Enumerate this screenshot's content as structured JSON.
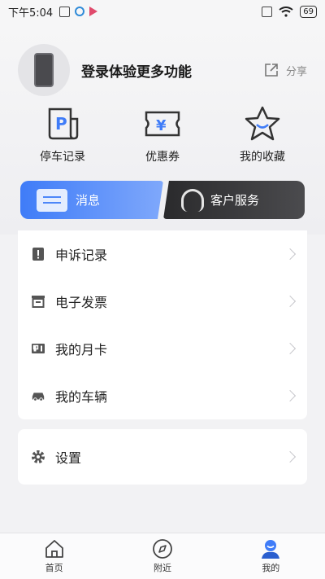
{
  "status_bar": {
    "time": "下午5:04",
    "battery": "69"
  },
  "profile": {
    "login_text": "登录体验更多功能",
    "share_label": "分享"
  },
  "quick_actions": [
    {
      "label": "停车记录",
      "icon": "parking-receipt-icon"
    },
    {
      "label": "优惠券",
      "icon": "coupon-icon"
    },
    {
      "label": "我的收藏",
      "icon": "star-icon"
    }
  ],
  "banners": {
    "messages": "消息",
    "customer_service": "客户服务"
  },
  "menu": [
    {
      "label": "申诉记录",
      "icon": "appeal-icon"
    },
    {
      "label": "电子发票",
      "icon": "invoice-icon"
    },
    {
      "label": "我的月卡",
      "icon": "monthly-card-icon"
    },
    {
      "label": "我的车辆",
      "icon": "car-icon"
    }
  ],
  "settings": {
    "label": "设置"
  },
  "tabs": [
    {
      "label": "首页",
      "icon": "home-icon"
    },
    {
      "label": "附近",
      "icon": "compass-icon"
    },
    {
      "label": "我的",
      "icon": "user-icon"
    }
  ],
  "colors": {
    "accent": "#3f7cf8",
    "dark": "#2a2a2c",
    "bg": "#f2f2f4"
  }
}
